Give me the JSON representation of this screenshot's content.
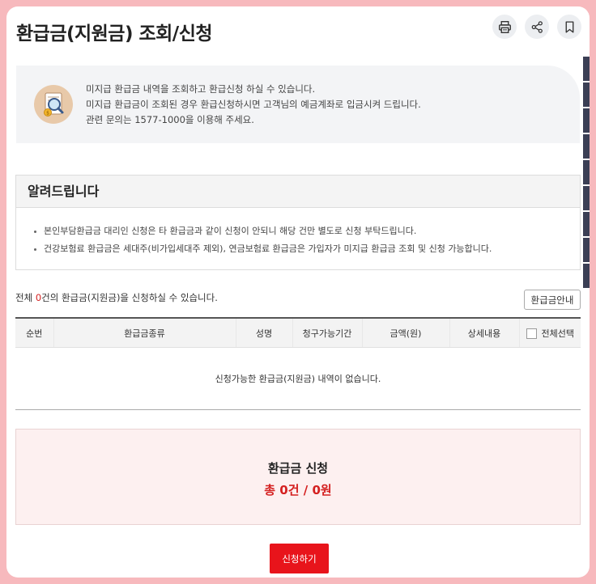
{
  "page": {
    "title": "환급금(지원금) 조회/신청"
  },
  "toolbar": {
    "print_icon": "print-icon",
    "share_icon": "share-icon",
    "bookmark_icon": "bookmark-icon"
  },
  "info": {
    "icon": "magnifier-coin-icon",
    "lines": [
      "미지급 환급금 내역을 조회하고 환급신청 하실 수 있습니다.",
      "미지급 환급금이 조회된 경우 환급신청하시면 고객님의 예금계좌로 입금시켜 드립니다.",
      "관련 문의는 1577-1000을 이용해 주세요."
    ]
  },
  "notice": {
    "title": "알려드립니다",
    "items": [
      "본인부담환급금 대리인 신청은 타 환급금과 같이 신청이 안되니 해당 건만 별도로 신청 부탁드립니다.",
      "건강보험료 환급금은 세대주(비가입세대주 제외), 연금보험료 환급금은 가입자가 미지급 환급금 조회 및 신청 가능합니다."
    ]
  },
  "summary": {
    "prefix": "전체 ",
    "count": "0",
    "suffix": "건의 환급금(지원금)을 신청하실 수 있습니다."
  },
  "guide_button": "환급금안내",
  "table": {
    "headers": [
      "순번",
      "환급금종류",
      "성명",
      "청구가능기간",
      "금액(원)",
      "상세내용",
      "전체선택"
    ],
    "empty_message": "신청가능한 환급금(지원금) 내역이 없습니다."
  },
  "apply": {
    "title": "환급금 신청",
    "total": "총 0건 / 0원"
  },
  "submit_button": "신청하기",
  "colors": {
    "accent": "#e8141b",
    "background_border": "#f7b9bd"
  }
}
